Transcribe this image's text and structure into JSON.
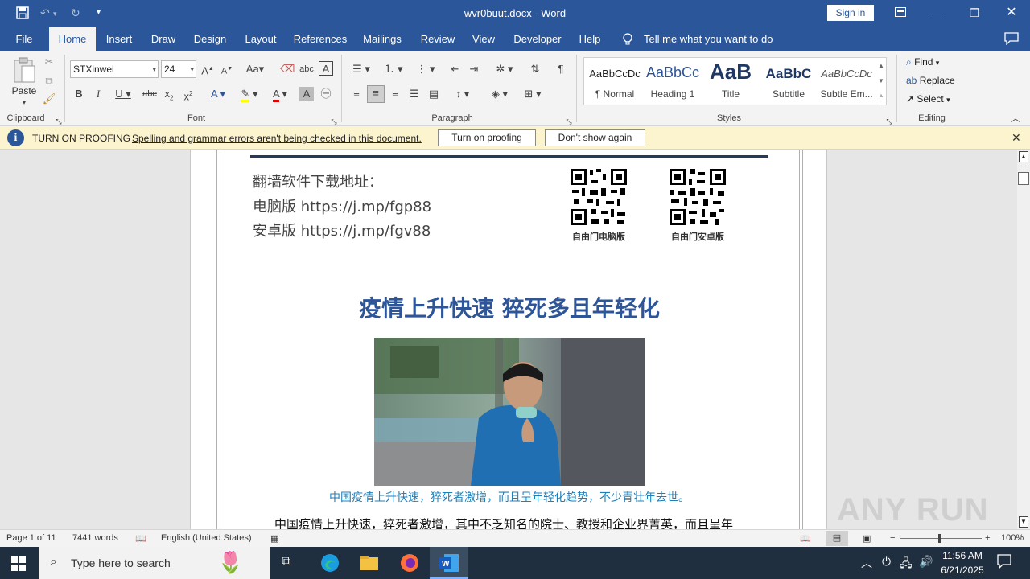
{
  "window": {
    "title": "wvr0buut.docx  -  Word",
    "sign_in": "Sign in"
  },
  "tabs": [
    "File",
    "Home",
    "Insert",
    "Draw",
    "Design",
    "Layout",
    "References",
    "Mailings",
    "Review",
    "View",
    "Developer",
    "Help"
  ],
  "active_tab": "Home",
  "tell_me": "Tell me what you want to do",
  "ribbon": {
    "clipboard": {
      "label": "Clipboard",
      "paste": "Paste"
    },
    "font": {
      "label": "Font",
      "name": "STXinwei",
      "size": "24"
    },
    "paragraph": {
      "label": "Paragraph"
    },
    "styles": {
      "label": "Styles",
      "items": [
        {
          "preview": "AaBbCcDc",
          "name": "¶ Normal"
        },
        {
          "preview": "AaBbCc",
          "name": "Heading 1"
        },
        {
          "preview": "AaB",
          "name": "Title"
        },
        {
          "preview": "AaBbC",
          "name": "Subtitle"
        },
        {
          "preview": "AaBbCcDc",
          "name": "Subtle Em..."
        }
      ]
    },
    "editing": {
      "label": "Editing",
      "find": "Find",
      "replace": "Replace",
      "select": "Select"
    }
  },
  "infobar": {
    "heading": "TURN ON PROOFING",
    "message": "Spelling and grammar errors aren't being checked in this document.",
    "turn_on": "Turn on proofing",
    "dont_show": "Don't show again"
  },
  "document": {
    "header_lines": [
      "翻墙软件下载地址：",
      "电脑版 https://j.mp/fgp88",
      "安卓版 https://j.mp/fgv88"
    ],
    "qr_captions": [
      "自由门电脑版",
      "自由门安卓版"
    ],
    "headline": "疫情上升快速  猝死多且年轻化",
    "photo_caption": "中国疫情上升快速，猝死者激增，而且呈年轻化趋势，不少青壮年去世。",
    "body_first_line": "中国疫情上升快速，猝死者激增，其中不乏知名的院士、教授和企业界菁英，而且呈年"
  },
  "status": {
    "page": "Page 1 of 11",
    "words": "7441 words",
    "language": "English (United States)",
    "zoom": "100%"
  },
  "taskbar": {
    "search_placeholder": "Type here to search",
    "time": "11:56 AM",
    "date": "6/21/2025"
  },
  "watermark": "ANY RUN"
}
